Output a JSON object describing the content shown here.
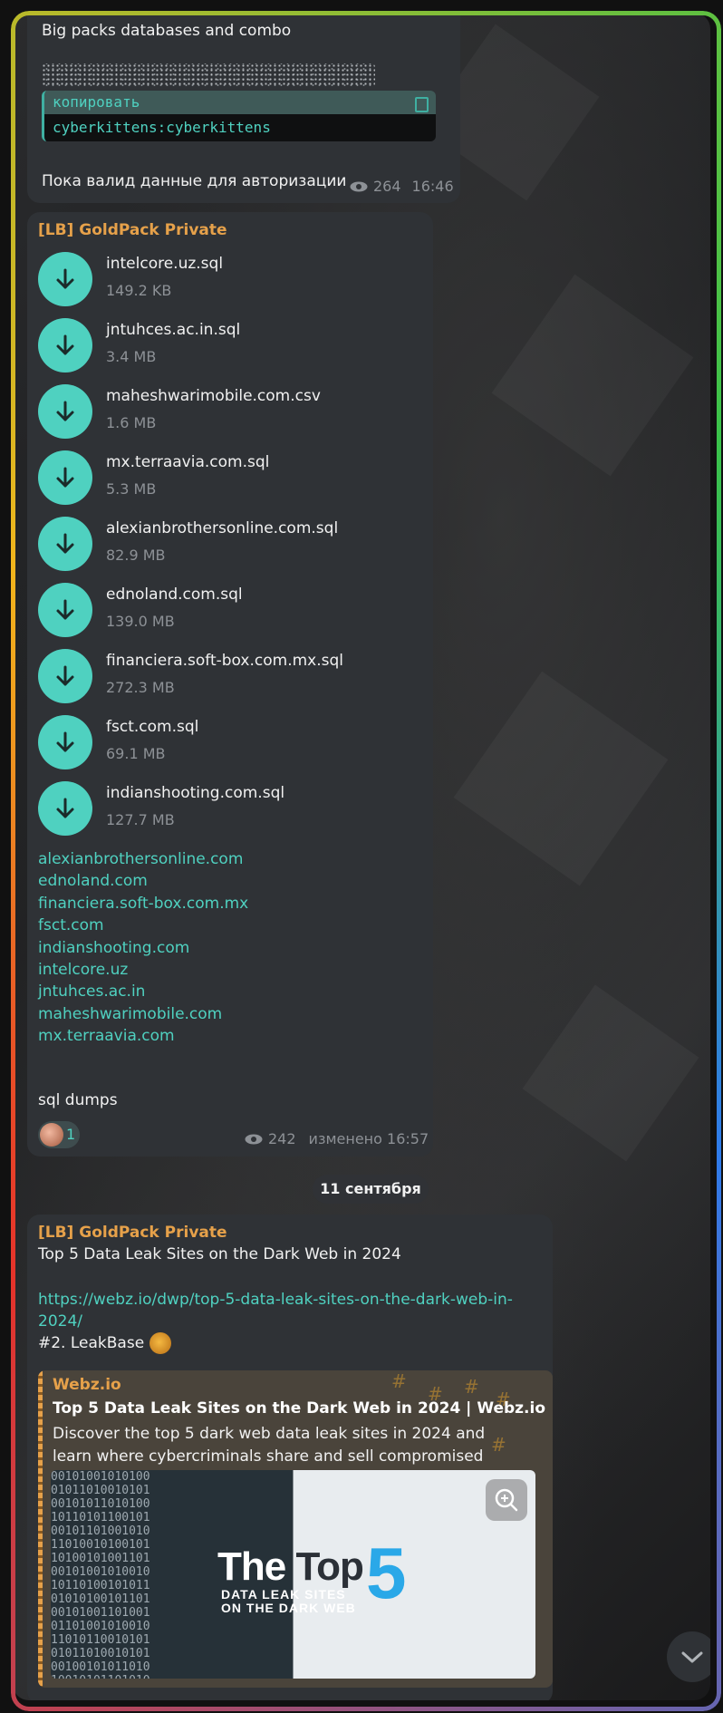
{
  "message1": {
    "text_top": "Big packs databases and combo",
    "code_label": "копировать",
    "code_value": "cyberkittens:cyberkittens",
    "text_bottom": "Пока валид данные для авторизации",
    "views": "264",
    "time": "16:46"
  },
  "message2": {
    "sender": "[LB] GoldPack Private",
    "files": [
      {
        "name": "intelcore.uz.sql",
        "size": "149.2 KB"
      },
      {
        "name": "jntuhces.ac.in.sql",
        "size": "3.4 MB"
      },
      {
        "name": "maheshwarimobile.com.csv",
        "size": "1.6 MB"
      },
      {
        "name": "mx.terraavia.com.sql",
        "size": "5.3 MB"
      },
      {
        "name": "alexianbrothersonline.com.sql",
        "size": "82.9 MB"
      },
      {
        "name": "ednoland.com.sql",
        "size": "139.0 MB"
      },
      {
        "name": "financiera.soft-box.com.mx.sql",
        "size": "272.3 MB"
      },
      {
        "name": "fsct.com.sql",
        "size": "69.1 MB"
      },
      {
        "name": "indianshooting.com.sql",
        "size": "127.7 MB"
      }
    ],
    "links": [
      "alexianbrothersonline.com",
      "ednoland.com",
      "financiera.soft-box.com.mx",
      "fsct.com",
      "indianshooting.com",
      "intelcore.uz",
      "jntuhces.ac.in",
      "maheshwarimobile.com",
      "mx.terraavia.com"
    ],
    "caption": "sql dumps",
    "reaction_count": "1",
    "views": "242",
    "edited_time": "изменено 16:57"
  },
  "date_separator": "11 сентября",
  "message3": {
    "sender": "[LB] GoldPack Private",
    "title": "Top 5 Data Leak Sites on the Dark Web in 2024",
    "url": "https://webz.io/dwp/top-5-data-leak-sites-on-the-dark-web-in-2024/",
    "leak_line": "#2. LeakBase",
    "preview": {
      "site": "Webz.io",
      "title": "Top 5 Data Leak Sites on the Dark Web in 2024 | Webz.io",
      "description": "Discover the top 5 dark web data leak sites in 2024 and learn where cybercriminals share and sell compromised data.",
      "banner_the": "The",
      "banner_top": "Top",
      "banner_five": "5",
      "banner_line1": "DATA LEAK SITES",
      "banner_line2": "ON THE DARK WEB"
    }
  },
  "colors": {
    "accent": "#4fd1c0",
    "sender": "#e6a14a",
    "bubble": "#2f3236",
    "banner_blue": "#2aa8e8"
  },
  "icons": [
    "eye-icon",
    "copy-icon",
    "download-icon",
    "zoom-icon",
    "chevron-down-icon"
  ]
}
